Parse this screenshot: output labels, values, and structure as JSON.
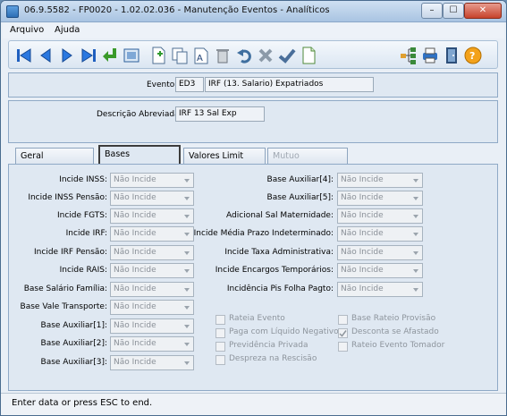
{
  "window": {
    "title": "06.9.5582 - FP0020 - 1.02.02.036 - Manutenção Eventos - Analíticos",
    "controls": {
      "minimize": "–",
      "maximize": "☐",
      "close": "✕"
    }
  },
  "menu": {
    "items": [
      {
        "label": "Arquivo"
      },
      {
        "label": "Ajuda"
      }
    ]
  },
  "toolbar": {
    "icons": [
      "first-record",
      "previous-record",
      "next-record",
      "last-record",
      "confirm-enter",
      "view-detail",
      "new-document",
      "copy",
      "edit-text",
      "delete",
      "undo",
      "cancel",
      "check",
      "new-blank",
      "tree",
      "print",
      "exit",
      "help"
    ]
  },
  "header": {
    "evento_label": "Evento:",
    "evento_code": "ED3",
    "evento_name": "IRF (13. Salario) Expatriados",
    "descricao_label": "Descrição Abreviada:",
    "descricao_value": "IRF 13 Sal Exp"
  },
  "tabs": [
    {
      "label": "Geral",
      "state": "normal"
    },
    {
      "label": "Bases",
      "state": "active"
    },
    {
      "label": "Valores Limit",
      "state": "normal"
    },
    {
      "label": "Mutuo",
      "state": "disabled"
    }
  ],
  "bases": {
    "left_fields": [
      {
        "label": "Incide INSS:",
        "value": "Não Incide"
      },
      {
        "label": "Incide INSS Pensão:",
        "value": "Não Incide"
      },
      {
        "label": "Incide FGTS:",
        "value": "Não Incide"
      },
      {
        "label": "Incide IRF:",
        "value": "Não Incide"
      },
      {
        "label": "Incide IRF Pensão:",
        "value": "Não Incide"
      },
      {
        "label": "Incide RAIS:",
        "value": "Não Incide"
      },
      {
        "label": "Base Salário Família:",
        "value": "Não Incide"
      },
      {
        "label": "Base Vale Transporte:",
        "value": "Não Incide"
      },
      {
        "label": "Base Auxiliar[1]:",
        "value": "Não Incide"
      },
      {
        "label": "Base Auxiliar[2]:",
        "value": "Não Incide"
      },
      {
        "label": "Base Auxiliar[3]:",
        "value": "Não Incide"
      }
    ],
    "right_fields": [
      {
        "label": "Base Auxiliar[4]:",
        "value": "Não Incide"
      },
      {
        "label": "Base Auxiliar[5]:",
        "value": "Não Incide"
      },
      {
        "label": "Adicional Sal Maternidade:",
        "value": "Não Incide"
      },
      {
        "label": "Incide Média Prazo Indeterminado:",
        "value": "Não Incide"
      },
      {
        "label": "Incide Taxa Administrativa:",
        "value": "Não Incide"
      },
      {
        "label": "Incide Encargos Temporários:",
        "value": "Não Incide"
      },
      {
        "label": "Incidência Pis Folha Pagto:",
        "value": "Não Incide"
      }
    ],
    "checkboxes": [
      {
        "label": "Rateia Evento",
        "checked": false
      },
      {
        "label": "Paga com Líquido Negativo",
        "checked": false
      },
      {
        "label": "Previdência Privada",
        "checked": false
      },
      {
        "label": "Despreza na Rescisão",
        "checked": false
      },
      {
        "label": "Base Rateio Provisão",
        "checked": false
      },
      {
        "label": "Desconta se Afastado",
        "checked": true
      },
      {
        "label": "Rateio Evento Tomador",
        "checked": false
      }
    ]
  },
  "status": {
    "text": "Enter data or press ESC to end."
  }
}
